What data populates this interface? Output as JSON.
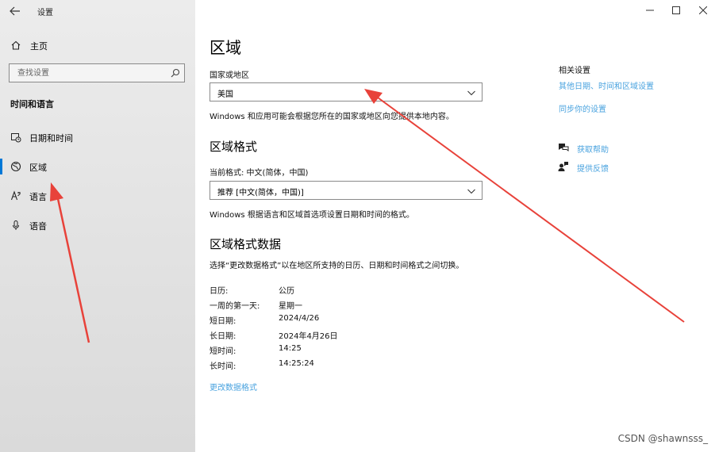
{
  "window": {
    "title": "设置",
    "controls": {
      "minimize": "—",
      "maximize": "☐",
      "close": "✕"
    }
  },
  "sidebar": {
    "home_label": "主页",
    "search_placeholder": "查找设置",
    "section_title": "时间和语言",
    "items": [
      {
        "label": "日期和时间",
        "icon": "clock-calendar-icon"
      },
      {
        "label": "区域",
        "icon": "globe-region-icon",
        "active": true
      },
      {
        "label": "语言",
        "icon": "language-icon"
      },
      {
        "label": "语音",
        "icon": "microphone-icon"
      }
    ]
  },
  "main": {
    "title": "区域",
    "country": {
      "label": "国家或地区",
      "value": "美国",
      "description": "Windows 和应用可能会根据您所在的国家或地区向您提供本地内容。"
    },
    "format": {
      "heading": "区域格式",
      "current_label": "当前格式: 中文(简体，中国)",
      "value": "推荐 [中文(简体，中国)]",
      "description": "Windows 根据语言和区域首选项设置日期和时间的格式。"
    },
    "format_data": {
      "heading": "区域格式数据",
      "description": "选择“更改数据格式”以在地区所支持的日历、日期和时间格式之间切换。",
      "rows": [
        {
          "key": "日历:",
          "value": "公历"
        },
        {
          "key": "一周的第一天:",
          "value": "星期一"
        },
        {
          "key": "短日期:",
          "value": "2024/4/26"
        },
        {
          "key": "长日期:",
          "value": "2024年4月26日"
        },
        {
          "key": "短时间:",
          "value": "14:25"
        },
        {
          "key": "长时间:",
          "value": "14:25:24"
        }
      ],
      "change_link": "更改数据格式"
    }
  },
  "related": {
    "title": "相关设置",
    "links": [
      "其他日期、时间和区域设置",
      "同步你的设置"
    ],
    "help": "获取帮助",
    "feedback": "提供反馈"
  },
  "watermark": "CSDN @shawnsss_",
  "colors": {
    "accent": "#0078d7",
    "link": "#4aa3df",
    "arrow": "#e8423a"
  }
}
